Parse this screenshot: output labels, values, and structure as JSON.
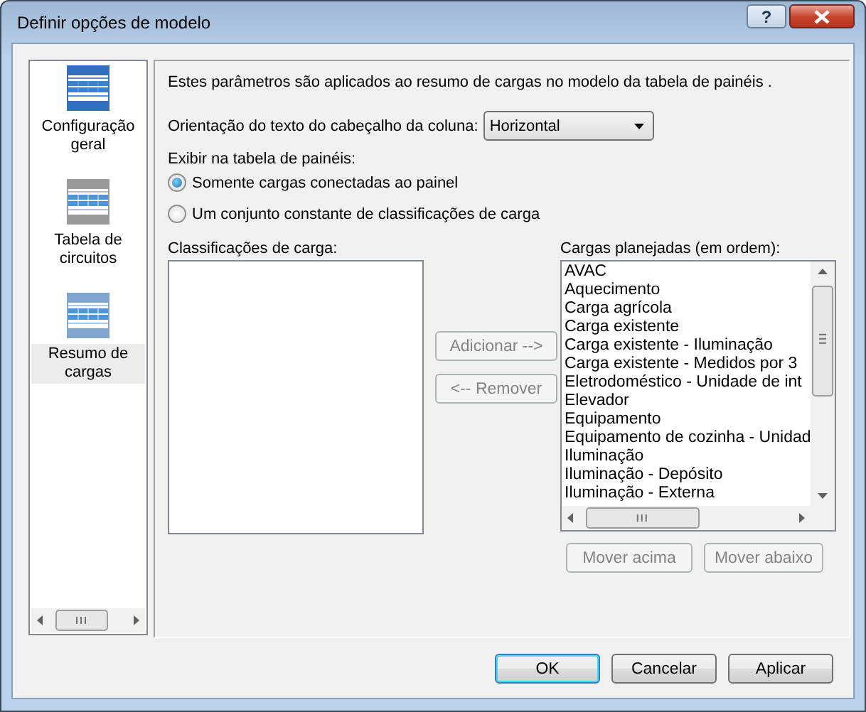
{
  "window": {
    "title": "Definir opções de modelo",
    "help_button": "?"
  },
  "sidebar": {
    "items": [
      {
        "label": "Configuração geral",
        "kind": "general",
        "selected": false
      },
      {
        "label": "Tabela de circuitos",
        "kind": "circuits",
        "selected": false
      },
      {
        "label": "Resumo de cargas",
        "kind": "loads",
        "selected": true
      }
    ]
  },
  "description": "Estes parâmetros são aplicados ao resumo de cargas no modelo da tabela de painéis .",
  "orientation": {
    "label": "Orientação do texto do cabeçalho da coluna:",
    "value": "Horizontal"
  },
  "display": {
    "label": "Exibir na tabela de painéis:",
    "options": [
      {
        "label": "Somente cargas conectadas ao painel",
        "selected": true
      },
      {
        "label": "Um conjunto constante de classificações de carga",
        "selected": false
      }
    ]
  },
  "classifications": {
    "label": "Classificações de carga:"
  },
  "planned": {
    "label": "Cargas planejadas (em ordem):",
    "items": [
      "AVAC",
      "Aquecimento",
      "Carga agrícola",
      "Carga existente",
      "Carga existente - Iluminação",
      "Carga existente - Medidos por 3",
      "Eletrodoméstico - Unidade de int",
      "Elevador",
      "Equipamento",
      "Equipamento de cozinha - Unidad",
      "Iluminação",
      "Iluminação - Depósito",
      "Iluminação - Externa"
    ]
  },
  "transfer_buttons": [
    {
      "label": "Adicionar -->",
      "disabled": true
    },
    {
      "label": "<-- Remover",
      "disabled": true
    }
  ],
  "order_buttons": [
    {
      "label": "Mover acima",
      "disabled": true
    },
    {
      "label": "Mover abaixo",
      "disabled": true
    }
  ],
  "footer_buttons": [
    {
      "label": "OK",
      "default": true
    },
    {
      "label": "Cancelar",
      "default": false
    },
    {
      "label": "Aplicar",
      "default": false
    }
  ]
}
